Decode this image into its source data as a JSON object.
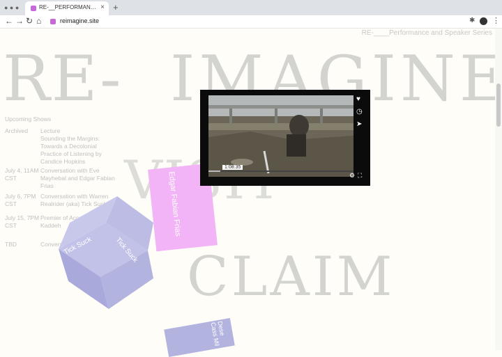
{
  "browser": {
    "tab_title": "RE-__PERFORMANCE AND SPE...",
    "tab_close": "×",
    "new_tab": "+",
    "address": "reimagine.site",
    "nav": {
      "back": "←",
      "forward": "→",
      "reload": "↻",
      "home": "⌂"
    },
    "menu": "⋮"
  },
  "page": {
    "series_title": "RE-____Performance and Speaker Series",
    "words": {
      "re": "RE-",
      "imagine": "IMAGINE",
      "visit": "VISIT",
      "claim": "CLAIM"
    },
    "schedule": {
      "heading": "Upcoming Shows",
      "rows": [
        {
          "when": "Archived",
          "what": "Lecture\nSounding the Margins: Towards a Decolonial Practice of Listening by Candice Hopkins"
        },
        {
          "when": "July 4, 11AM CST",
          "what": "Conversation with Eve Mayhebal and Edgar Fabian Frias"
        },
        {
          "when": "July 6, 7PM CST",
          "what": "Conversation with Warren Realrider (aka) Tick Suck"
        },
        {
          "when": "July 15, 7PM CST",
          "what": "Premier of Accelerated Kaddeh"
        },
        {
          "when": "TBD",
          "what": "Conversation with Cassandra"
        }
      ]
    },
    "cube_label_top": "Tick Suck",
    "cube_label_side": "Tick Suck",
    "pink_card": "Edgar Fabian Frias",
    "bottom_card": "Dese Cass Mil"
  },
  "video": {
    "timecode": "1:08:35",
    "progress": 0.08,
    "icons": {
      "like": "heart-icon",
      "watch_later": "clock-icon",
      "share": "send-icon",
      "settings": "gear-icon",
      "fullscreen": "fullscreen-icon"
    }
  },
  "colors": {
    "cube": "#b3b3e0",
    "pink": "#f2b4f6",
    "bigword": "#d3d3d0",
    "background": "#fefdf8"
  }
}
